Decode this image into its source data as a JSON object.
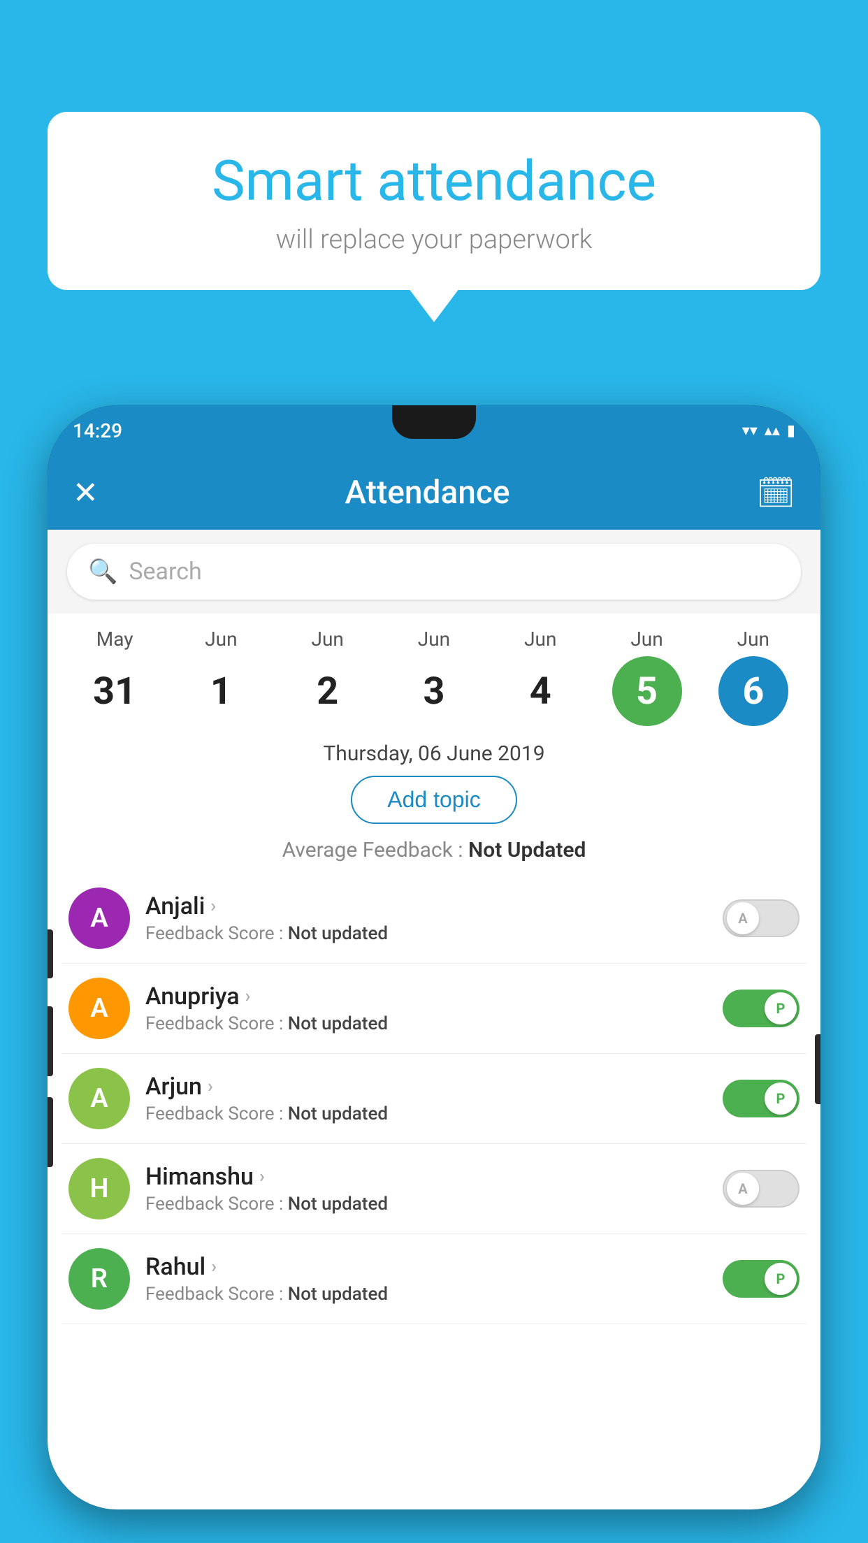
{
  "app": {
    "background_color": "#29b6e8"
  },
  "speech_bubble": {
    "title": "Smart attendance",
    "subtitle": "will replace your paperwork"
  },
  "phone": {
    "status_bar": {
      "time": "14:29",
      "wifi_icon": "▼",
      "signal_icon": "▲",
      "battery_icon": "▮"
    },
    "app_bar": {
      "close_icon": "✕",
      "title": "Attendance",
      "calendar_icon": "📅"
    },
    "search": {
      "placeholder": "Search"
    },
    "calendar": {
      "days": [
        {
          "month": "May",
          "date": "31",
          "style": "normal"
        },
        {
          "month": "Jun",
          "date": "1",
          "style": "normal"
        },
        {
          "month": "Jun",
          "date": "2",
          "style": "normal"
        },
        {
          "month": "Jun",
          "date": "3",
          "style": "normal"
        },
        {
          "month": "Jun",
          "date": "4",
          "style": "normal"
        },
        {
          "month": "Jun",
          "date": "5",
          "style": "today"
        },
        {
          "month": "Jun",
          "date": "6",
          "style": "selected"
        }
      ]
    },
    "selected_date": "Thursday, 06 June 2019",
    "add_topic_label": "Add topic",
    "avg_feedback_label": "Average Feedback :",
    "avg_feedback_value": "Not Updated",
    "students": [
      {
        "name": "Anjali",
        "avatar_letter": "A",
        "avatar_color": "#9c27b0",
        "feedback_label": "Feedback Score :",
        "feedback_value": "Not updated",
        "toggle": "off",
        "toggle_letter": "A"
      },
      {
        "name": "Anupriya",
        "avatar_letter": "A",
        "avatar_color": "#ff9800",
        "feedback_label": "Feedback Score :",
        "feedback_value": "Not updated",
        "toggle": "on",
        "toggle_letter": "P"
      },
      {
        "name": "Arjun",
        "avatar_letter": "A",
        "avatar_color": "#8bc34a",
        "feedback_label": "Feedback Score :",
        "feedback_value": "Not updated",
        "toggle": "on",
        "toggle_letter": "P"
      },
      {
        "name": "Himanshu",
        "avatar_letter": "H",
        "avatar_color": "#8bc34a",
        "feedback_label": "Feedback Score :",
        "feedback_value": "Not updated",
        "toggle": "off",
        "toggle_letter": "A"
      },
      {
        "name": "Rahul",
        "avatar_letter": "R",
        "avatar_color": "#4caf50",
        "feedback_label": "Feedback Score :",
        "feedback_value": "Not updated",
        "toggle": "on",
        "toggle_letter": "P"
      }
    ]
  }
}
